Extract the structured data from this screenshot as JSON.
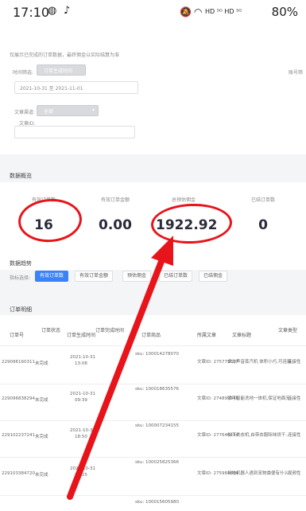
{
  "status_bar": {
    "time": "17:10",
    "indicators": "HD ⁵ᴳ HD ⁵ᴳ",
    "battery": "80%"
  },
  "filters": {
    "note": "仅展示已完成的订单数据，最终佣金以实际结算为准",
    "time_label": "时间筛选:",
    "time_type": "订单生成时间",
    "date_range": "2021-10-31 至 2021-11-01",
    "right_label": "账号筛",
    "channel_label": "文章渠道:",
    "channel_value": "全部",
    "article_label": "文章ID:"
  },
  "overview": {
    "title": "数据概览",
    "metrics": [
      {
        "label": "有效订单数",
        "value": "16"
      },
      {
        "label": "有效订单金额",
        "value": "0.00"
      },
      {
        "label": "总预估佣金",
        "value": "1922.92"
      },
      {
        "label": "已结订单数",
        "value": "0"
      }
    ]
  },
  "trend": {
    "title": "数据趋势",
    "select_label": "指标选择:",
    "chips": [
      "有效订单数",
      "有效订单金额",
      "预估佣金",
      "已结订单数",
      "已结佣金"
    ]
  },
  "details": {
    "title": "订单明细",
    "headers": [
      "订单号",
      "订单状态",
      "订单生成时间",
      "订单完成时间",
      "订单商品",
      "所属文章",
      "文章标题",
      "文章类型"
    ],
    "rows": [
      {
        "id": "229096160311",
        "status": "未完成",
        "date": "2021-10-31",
        "time": "13:08",
        "sku": "sku: 100014278070",
        "article": "文章ID: 275779697",
        "title": "卓力声音蒸汽机 体积小巧,可连接..",
        "type": "连接性"
      },
      {
        "id": "229096838294",
        "status": "未完成",
        "date": "2021-10-31",
        "time": "09:39",
        "sku": "sku: 100018635576",
        "article": "文章ID: 274899546",
        "title": "添可智能洗地一体机,保证地面无..",
        "type": "连接性"
      },
      {
        "id": "229102237241",
        "status": "未完成",
        "date": "2021-10-31",
        "time": "18:50",
        "sku": "sku: 100007234155",
        "article": "文章ID: 277640434",
        "title": "松下洗衣机,自带衣服除味烘干..",
        "type": "连接性"
      },
      {
        "id": "229103384720",
        "status": "未完成",
        "date": "2021-10-31",
        "time": "17:25",
        "sku": "sku: 100025825366",
        "article": "文章ID: 275984604",
        "title": "扫地机器人遇到宠物粪便有什么..",
        "type": "视频性"
      },
      {
        "id": "",
        "status": "",
        "date": "",
        "time": "",
        "sku": "sku: 100015605980",
        "article": "",
        "title": "",
        "type": ""
      }
    ]
  },
  "colors": {
    "accent": "#3b82f6",
    "annotation": "#e8141b"
  }
}
